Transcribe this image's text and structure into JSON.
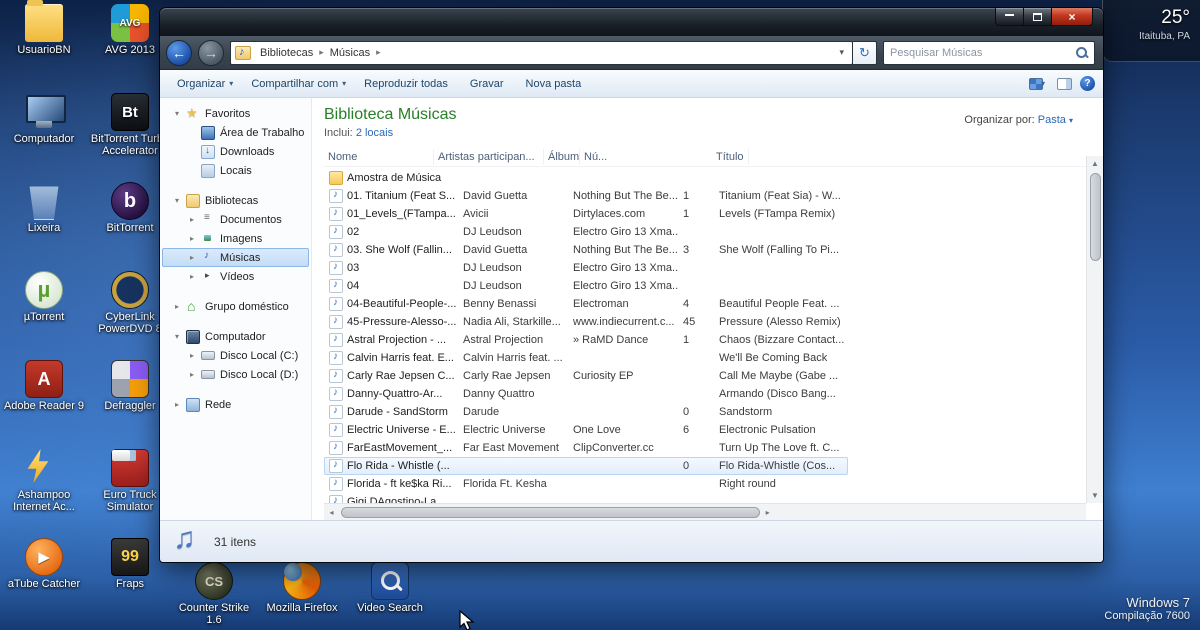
{
  "desktop": {
    "weather": {
      "temp": "25°",
      "location": "Itaituba, PA"
    },
    "watermark": {
      "line1": "Windows 7",
      "line2": "Compilação 7600"
    },
    "icons_left": [
      {
        "label": "UsuarioBN",
        "icon": "ic-folderuser"
      },
      {
        "label": "AVG 2013",
        "icon": "ic-avg"
      },
      {
        "label": "Computador",
        "icon": "ic-computer"
      },
      {
        "label": "BitTorrent Turbo Accelerator",
        "icon": "ic-btturbo"
      },
      {
        "label": "Lixeira",
        "icon": "ic-lixeira"
      },
      {
        "label": "BitTorrent",
        "icon": "ic-bittorrent"
      },
      {
        "label": "µTorrent",
        "icon": "ic-utorrent"
      },
      {
        "label": "CyberLink PowerDVD 8",
        "icon": "ic-powerdvd"
      },
      {
        "label": "Adobe Reader 9",
        "icon": "ic-adobe"
      },
      {
        "label": "Defraggler",
        "icon": "ic-defraggler"
      },
      {
        "label": "Ashampoo Internet Ac...",
        "icon": "ic-ashampoo"
      },
      {
        "label": "Euro Truck Simulator",
        "icon": "ic-eurotruck"
      },
      {
        "label": "aTube Catcher",
        "icon": "ic-atube"
      },
      {
        "label": "Fraps",
        "icon": "ic-fraps"
      }
    ],
    "icons_bottom": [
      {
        "label": "Counter Strike 1.6",
        "icon": "ic-cs"
      },
      {
        "label": "Mozilla Firefox",
        "icon": "ic-firefox"
      },
      {
        "label": "Video Search",
        "icon": "ic-vsearch"
      }
    ]
  },
  "window": {
    "nav": {
      "breadcrumb": [
        {
          "label": "Bibliotecas"
        },
        {
          "label": "Músicas"
        }
      ],
      "crumb_sep": "▸",
      "search_placeholder": "Pesquisar Músicas",
      "back_glyph": "←",
      "fwd_glyph": "→",
      "refresh_glyph": "↻",
      "dropdown_glyph": "▾"
    },
    "toolbar": {
      "items": [
        {
          "label": "Organizar",
          "arrow": "▾"
        },
        {
          "label": "Compartilhar com",
          "arrow": "▾"
        },
        {
          "label": "Reproduzir todas",
          "arrow": ""
        },
        {
          "label": "Gravar",
          "arrow": ""
        },
        {
          "label": "Nova pasta",
          "arrow": ""
        }
      ]
    },
    "sidebar": {
      "items": [
        {
          "label": "Favoritos",
          "icon": "mi-star",
          "arrow": "▾",
          "ind": "ind0",
          "cls": ""
        },
        {
          "label": "Área de Trabalho",
          "icon": "mi-desktop",
          "arrow": "",
          "ind": "ind1",
          "cls": ""
        },
        {
          "label": "Downloads",
          "icon": "mi-downloads",
          "arrow": "",
          "ind": "ind1",
          "cls": ""
        },
        {
          "label": "Locais",
          "icon": "mi-places",
          "arrow": "",
          "ind": "ind1",
          "cls": "gap-after"
        },
        {
          "label": "Bibliotecas",
          "icon": "mi-fold",
          "arrow": "▾",
          "ind": "ind0",
          "cls": ""
        },
        {
          "label": "Documentos",
          "icon": "mi-docs",
          "arrow": "▸",
          "ind": "ind1",
          "cls": ""
        },
        {
          "label": "Imagens",
          "icon": "mi-img",
          "arrow": "▸",
          "ind": "ind1",
          "cls": ""
        },
        {
          "label": "Músicas",
          "icon": "mi-music",
          "arrow": "▸",
          "ind": "ind1",
          "cls": "sel"
        },
        {
          "label": "Vídeos",
          "icon": "mi-video",
          "arrow": "▸",
          "ind": "ind1",
          "cls": "gap-after"
        },
        {
          "label": "Grupo doméstico",
          "icon": "mi-home",
          "arrow": "▸",
          "ind": "ind0",
          "cls": "gap-after"
        },
        {
          "label": "Computador",
          "icon": "mi-computer",
          "arrow": "▾",
          "ind": "ind0",
          "cls": ""
        },
        {
          "label": "Disco Local (C:)",
          "icon": "mi-disk",
          "arrow": "▸",
          "ind": "ind1",
          "cls": ""
        },
        {
          "label": "Disco Local (D:)",
          "icon": "mi-disk",
          "arrow": "▸",
          "ind": "ind1",
          "cls": "gap-after"
        },
        {
          "label": "Rede",
          "icon": "mi-network",
          "arrow": "▸",
          "ind": "ind0",
          "cls": ""
        }
      ]
    },
    "content": {
      "title": "Biblioteca Músicas",
      "includes_label": "Inclui:",
      "includes_link": "2 locais",
      "arrange_label": "Organizar por:",
      "arrange_value": "Pasta",
      "columns": [
        "Nome",
        "Artistas participan...",
        "Álbum",
        "Nú...",
        "Título"
      ],
      "rows": [
        {
          "icon": "fi-folder",
          "name": "Amostra de Música",
          "artists": "",
          "album": "",
          "num": "",
          "title": "",
          "cls": ""
        },
        {
          "icon": "fi-music",
          "name": "01. Titanium (Feat S...",
          "artists": "David Guetta",
          "album": "Nothing But The Be...",
          "num": "1",
          "title": "Titanium (Feat Sia) - W...",
          "cls": ""
        },
        {
          "icon": "fi-music",
          "name": "01_Levels_(FTampa...",
          "artists": "Avicii",
          "album": "Dirtylaces.com",
          "num": "1",
          "title": "Levels (FTampa Remix)",
          "cls": ""
        },
        {
          "icon": "fi-music",
          "name": "02",
          "artists": "DJ Leudson",
          "album": "Electro Giro 13 Xma...",
          "num": "",
          "title": "",
          "cls": ""
        },
        {
          "icon": "fi-music",
          "name": "03. She Wolf (Fallin...",
          "artists": "David Guetta",
          "album": "Nothing But The Be...",
          "num": "3",
          "title": "She Wolf (Falling To Pi...",
          "cls": ""
        },
        {
          "icon": "fi-music",
          "name": "03",
          "artists": "DJ Leudson",
          "album": "Electro Giro 13 Xma...",
          "num": "",
          "title": "",
          "cls": ""
        },
        {
          "icon": "fi-music",
          "name": "04",
          "artists": "DJ Leudson",
          "album": "Electro Giro 13 Xma...",
          "num": "",
          "title": "",
          "cls": ""
        },
        {
          "icon": "fi-music",
          "name": "04-Beautiful-People-...",
          "artists": "Benny Benassi",
          "album": "Electroman",
          "num": "4",
          "title": "Beautiful People Feat. ...",
          "cls": ""
        },
        {
          "icon": "fi-music",
          "name": "45-Pressure-Alesso-...",
          "artists": "Nadia Ali, Starkille...",
          "album": "www.indiecurrent.c...",
          "num": "45",
          "title": "Pressure (Alesso Remix)",
          "cls": ""
        },
        {
          "icon": "fi-music",
          "name": "Astral Projection - ...",
          "artists": "Astral Projection",
          "album": "» RaMD Dance",
          "num": "1",
          "title": "Chaos (Bizzare Contact...",
          "cls": ""
        },
        {
          "icon": "fi-music",
          "name": "Calvin Harris feat. E...",
          "artists": "Calvin Harris feat. ...",
          "album": "",
          "num": "",
          "title": "We'll Be Coming Back",
          "cls": ""
        },
        {
          "icon": "fi-music",
          "name": "Carly Rae Jepsen  C...",
          "artists": "Carly Rae Jepsen",
          "album": "Curiosity EP",
          "num": "",
          "title": "Call Me Maybe (Gabe ...",
          "cls": ""
        },
        {
          "icon": "fi-music",
          "name": "Danny-Quattro-Ar...",
          "artists": "Danny Quattro",
          "album": "",
          "num": "",
          "title": "Armando (Disco Bang...",
          "cls": ""
        },
        {
          "icon": "fi-music",
          "name": "Darude - SandStorm",
          "artists": "Darude",
          "album": "",
          "num": "0",
          "title": "Sandstorm",
          "cls": ""
        },
        {
          "icon": "fi-music",
          "name": "Electric Universe - E...",
          "artists": "Electric Universe",
          "album": "One Love",
          "num": "6",
          "title": "Electronic Pulsation",
          "cls": ""
        },
        {
          "icon": "fi-music",
          "name": "FarEastMovement_...",
          "artists": "Far East Movement",
          "album": "ClipConverter.cc",
          "num": "",
          "title": "Turn Up The Love ft. C...",
          "cls": ""
        },
        {
          "icon": "fi-music",
          "name": "Flo Rida - Whistle (...",
          "artists": "",
          "album": "",
          "num": "0",
          "title": "Flo Rida-Whistle (Cos...",
          "cls": "hover"
        },
        {
          "icon": "fi-music",
          "name": "Florida - ft ke$ka Ri...",
          "artists": "Florida Ft. Kesha",
          "album": "",
          "num": "",
          "title": "Right round",
          "cls": ""
        },
        {
          "icon": "fi-music",
          "name": "Gigi DAgostino-La ...",
          "artists": "",
          "album": "",
          "num": "",
          "title": "",
          "cls": ""
        }
      ]
    },
    "statusbar": {
      "count": "31 itens"
    }
  }
}
